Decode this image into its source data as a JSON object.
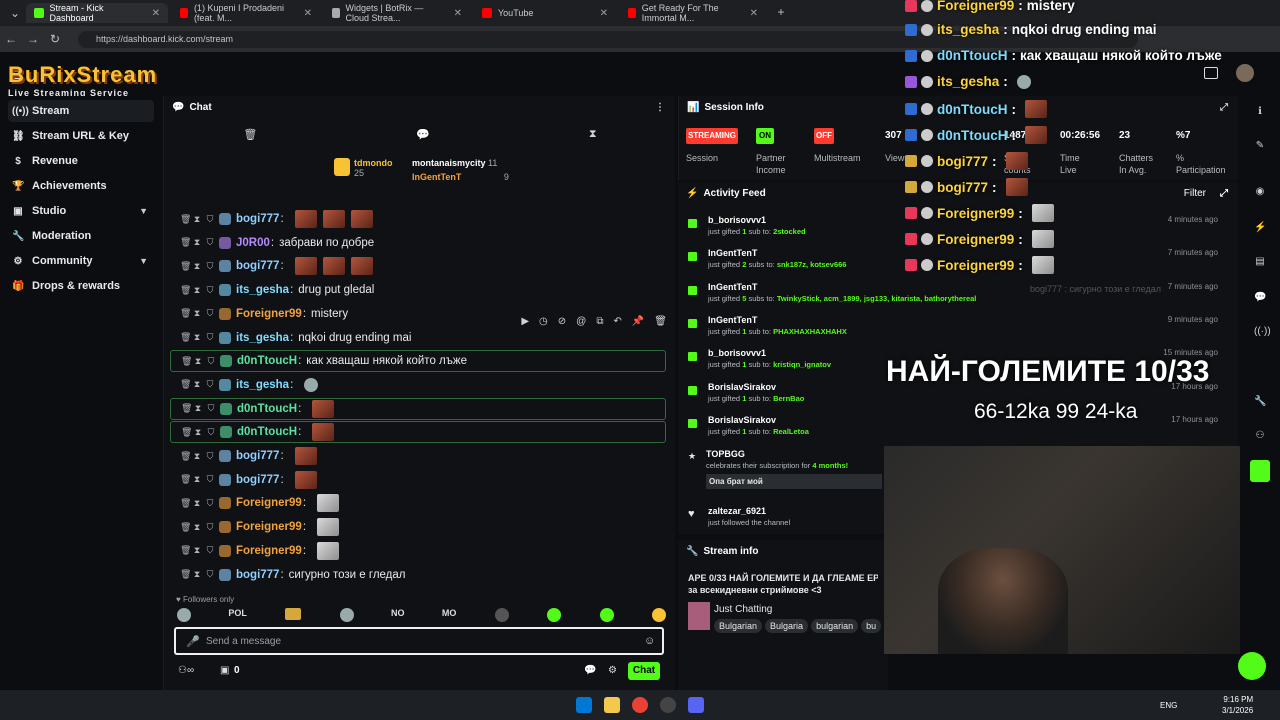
{
  "browser": {
    "tabs": [
      {
        "label": "Stream - Kick Dashboard",
        "color": "#53fc18"
      },
      {
        "label": "(1) Kupeni I Prodadeni (feat. M...",
        "color": "#ff0000"
      },
      {
        "label": "Widgets | BotRix — Cloud Strea...",
        "color": "#aaaaaa"
      },
      {
        "label": "YouTube",
        "color": "#ff0000"
      },
      {
        "label": "Get Ready For The Immortal M...",
        "color": "#ff0000"
      }
    ],
    "url": "https://dashboard.kick.com/stream"
  },
  "brand": {
    "title": "BuRixStream",
    "subtitle": "Live Streaming Service"
  },
  "sidebar": {
    "items": [
      {
        "label": "Stream",
        "icon": "broadcast-icon"
      },
      {
        "label": "Stream URL & Key",
        "icon": "link-icon"
      },
      {
        "label": "Revenue",
        "icon": "dollar-icon"
      },
      {
        "label": "Achievements",
        "icon": "trophy-icon"
      },
      {
        "label": "Studio",
        "icon": "studio-icon"
      },
      {
        "label": "Moderation",
        "icon": "wrench-icon"
      },
      {
        "label": "Community",
        "icon": "community-icon"
      },
      {
        "label": "Drops & rewards",
        "icon": "gift-icon"
      }
    ]
  },
  "chat": {
    "title": "Chat",
    "top_gifters": [
      {
        "name": "tdmondo",
        "count": "25"
      },
      {
        "name": "montanaismycity",
        "count": "11"
      },
      {
        "name": "InGentTenT",
        "count": "9"
      }
    ],
    "messages": [
      {
        "user": "bogi777",
        "text": "",
        "color": "#8fd0ff",
        "emotes": 3
      },
      {
        "user": "J0R00",
        "text": "забрави по добре",
        "color": "#b58cff",
        "emotes": 0
      },
      {
        "user": "bogi777",
        "text": "",
        "color": "#8fd0ff",
        "emotes": 3
      },
      {
        "user": "its_gesha",
        "text": "drug put gledal",
        "color": "#7fdbff",
        "emotes": 0
      },
      {
        "user": "Foreigner99",
        "text": "mistery",
        "color": "#f2a341",
        "emotes": 0
      },
      {
        "user": "its_gesha",
        "text": "nqkoi drug ending mai",
        "color": "#7fdbff",
        "emotes": 0
      },
      {
        "user": "d0nTtoucH",
        "text": "как хващаш някой който лъже",
        "color": "#5be3a0",
        "emotes": 0
      },
      {
        "user": "its_gesha",
        "text": "",
        "color": "#7fdbff",
        "emotes": 1
      },
      {
        "user": "d0nTtoucH",
        "text": "",
        "color": "#5be3a0",
        "emotes": 1
      },
      {
        "user": "d0nTtoucH",
        "text": "",
        "color": "#5be3a0",
        "emotes": 1
      },
      {
        "user": "bogi777",
        "text": "",
        "color": "#8fd0ff",
        "emotes": 1
      },
      {
        "user": "bogi777",
        "text": "",
        "color": "#8fd0ff",
        "emotes": 1
      },
      {
        "user": "Foreigner99",
        "text": "",
        "color": "#f2a341",
        "emotes": 1
      },
      {
        "user": "Foreigner99",
        "text": "",
        "color": "#f2a341",
        "emotes": 1
      },
      {
        "user": "Foreigner99",
        "text": "",
        "color": "#f2a341",
        "emotes": 1
      },
      {
        "user": "bogi777",
        "text": "сигурно този е гледал",
        "color": "#8fd0ff",
        "emotes": 0
      }
    ],
    "followers_only": "Followers only",
    "emote_bar": [
      "POL",
      "NO",
      "MO"
    ],
    "placeholder": "Send a message",
    "viewers_count": "0",
    "chat_button": "Chat"
  },
  "session": {
    "title": "Session Info",
    "pills": [
      {
        "label": "STREAMING",
        "bg": "#ff4a4a"
      },
      {
        "label": "ON",
        "bg": "#53fc18"
      },
      {
        "label": "OFF",
        "bg": "#ff3b30"
      }
    ],
    "pill_labels": [
      "Session",
      "Partner Income",
      "Multistream"
    ],
    "stats": [
      {
        "value": "307",
        "label": "Views"
      },
      {
        "value": "1487",
        "label": "Sub counts"
      },
      {
        "value": "00:26:56",
        "label": "Time Live"
      },
      {
        "value": "23",
        "label": "Chatters In Avg."
      },
      {
        "value": "%7",
        "label": "% Participation"
      }
    ]
  },
  "activity": {
    "title": "Activity Feed",
    "filter": "Filter",
    "items": [
      {
        "user": "b_borisovvv1",
        "action": "just gifted",
        "count": "1",
        "unit": "sub to:",
        "target": "2stocked",
        "time": "4 minutes ago"
      },
      {
        "user": "InGentTenT",
        "action": "just gifted",
        "count": "2",
        "unit": "subs to:",
        "target": "snk187z, kotsev666",
        "time": "7 minutes ago"
      },
      {
        "user": "InGentTenT",
        "action": "just gifted",
        "count": "5",
        "unit": "subs to:",
        "target": "TwinkyStick, acm_1899, jsg133, kitarista, bathorythereal",
        "time": "7 minutes ago"
      },
      {
        "user": "InGentTenT",
        "action": "just gifted",
        "count": "1",
        "unit": "sub to:",
        "target": "PHAXHAXHAXHAHX",
        "time": "9 minutes ago"
      },
      {
        "user": "b_borisovvv1",
        "action": "just gifted",
        "count": "1",
        "unit": "sub to:",
        "target": "kristiqn_ignatov",
        "time": "15 minutes ago"
      },
      {
        "user": "BorislavSirakov",
        "action": "just gifted",
        "count": "1",
        "unit": "sub to:",
        "target": "BernBao",
        "time": "17 hours ago"
      },
      {
        "user": "BorislavSirakov",
        "action": "just gifted",
        "count": "1",
        "unit": "sub to:",
        "target": "RealLetoa",
        "time": "17 hours ago"
      }
    ],
    "resub": {
      "user": "TOPBGG",
      "text": "celebrates their subscription for",
      "months": "4 months!",
      "message": "Опа брат мой"
    },
    "follow": {
      "user": "zaltezar_6921",
      "text": "just followed the channel"
    }
  },
  "stream_info": {
    "title": "Stream info",
    "stream_title": "APE 0/33 НАЙ ГОЛЕМИТЕ И ДА ГЛЕАМЕ ЕРИ",
    "stream_title_2": "за всекидневни стриймове <3",
    "category": "Just Chatting",
    "tags": [
      "Bulgarian",
      "Bulgaria",
      "bulgarian",
      "bu"
    ]
  },
  "overlay": {
    "lines": [
      {
        "user": "Foreigner99",
        "text": "mistery",
        "color": "#ffd43b"
      },
      {
        "user": "its_gesha",
        "text": "nqkoi drug ending mai",
        "color": "#ffd43b"
      },
      {
        "user": "d0nTtoucH",
        "text": "как хващаш някой който лъже",
        "color": "#7fdbff"
      },
      {
        "user": "its_gesha",
        "text": "",
        "color": "#ffd43b"
      },
      {
        "user": "d0nTtoucH",
        "text": "",
        "color": "#7fdbff"
      },
      {
        "user": "d0nTtoucH",
        "text": "",
        "color": "#7fdbff"
      },
      {
        "user": "bogi777",
        "text": "",
        "color": "#ffd43b"
      },
      {
        "user": "bogi777",
        "text": "",
        "color": "#ffd43b"
      },
      {
        "user": "Foreigner99",
        "text": "",
        "color": "#ffd43b"
      },
      {
        "user": "Foreigner99",
        "text": "",
        "color": "#ffd43b"
      },
      {
        "user": "Foreigner99",
        "text": "",
        "color": "#ffd43b"
      }
    ],
    "faded": "bogi777 : сигурно този е гледал",
    "big_title": "НАЙ-ГОЛЕМИТЕ 10/33",
    "big_sub": "66-12ka 99 24-ka"
  },
  "taskbar": {
    "lang": "ENG",
    "time": "9:16 PM",
    "date": "3/1/2026"
  }
}
